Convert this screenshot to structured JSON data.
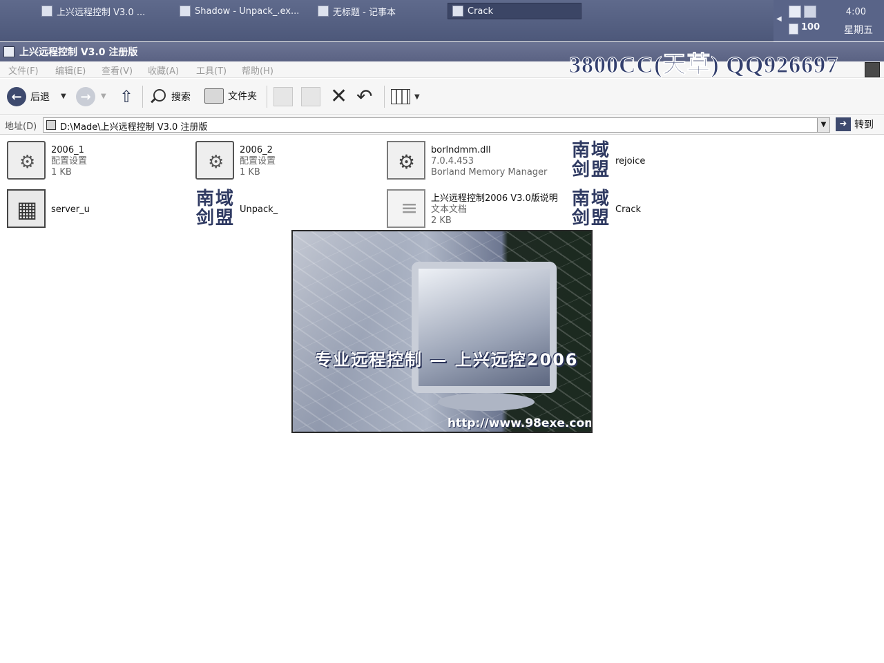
{
  "taskbar": {
    "tasks": [
      {
        "label": "上兴远程控制 V3.0 ..."
      },
      {
        "label": "Shadow - Unpack_.ex..."
      },
      {
        "label": "无标题 - 记事本"
      },
      {
        "label": "Crack"
      }
    ],
    "tray": {
      "battery": "100",
      "time": "4:00",
      "day": "星期五"
    }
  },
  "window": {
    "title": "上兴远程控制 V3.0 注册版",
    "watermark": "3800CC(天草) QQ926697"
  },
  "menu": {
    "items": [
      "文件(F)",
      "编辑(E)",
      "查看(V)",
      "收藏(A)",
      "工具(T)",
      "帮助(H)"
    ]
  },
  "toolbar": {
    "back_label": "后退",
    "search_label": "搜索",
    "folders_label": "文件夹"
  },
  "address": {
    "label": "地址(D)",
    "value": "D:\\Made\\上兴远程控制 V3.0 注册版",
    "go_label": "转到"
  },
  "files": [
    {
      "name": "2006_1",
      "type": "配置设置",
      "size": "1 KB"
    },
    {
      "name": "2006_2",
      "type": "配置设置",
      "size": "1 KB"
    },
    {
      "name": "borlndmm.dll",
      "version": "7.0.4.453",
      "desc": "Borland Memory Manager"
    },
    {
      "name": "rejoice"
    },
    {
      "name": "server_u"
    },
    {
      "name": "Unpack_"
    },
    {
      "name": "上兴远程控制2006 V3.0版说明",
      "type": "文本文档",
      "size": "2 KB"
    },
    {
      "name": "Crack"
    }
  ],
  "seal_chars": [
    "南",
    "域",
    "剑",
    "盟"
  ],
  "splash": {
    "title": "专业远程控制 — 上兴远控2006",
    "url": "http://www.98exe.com"
  }
}
